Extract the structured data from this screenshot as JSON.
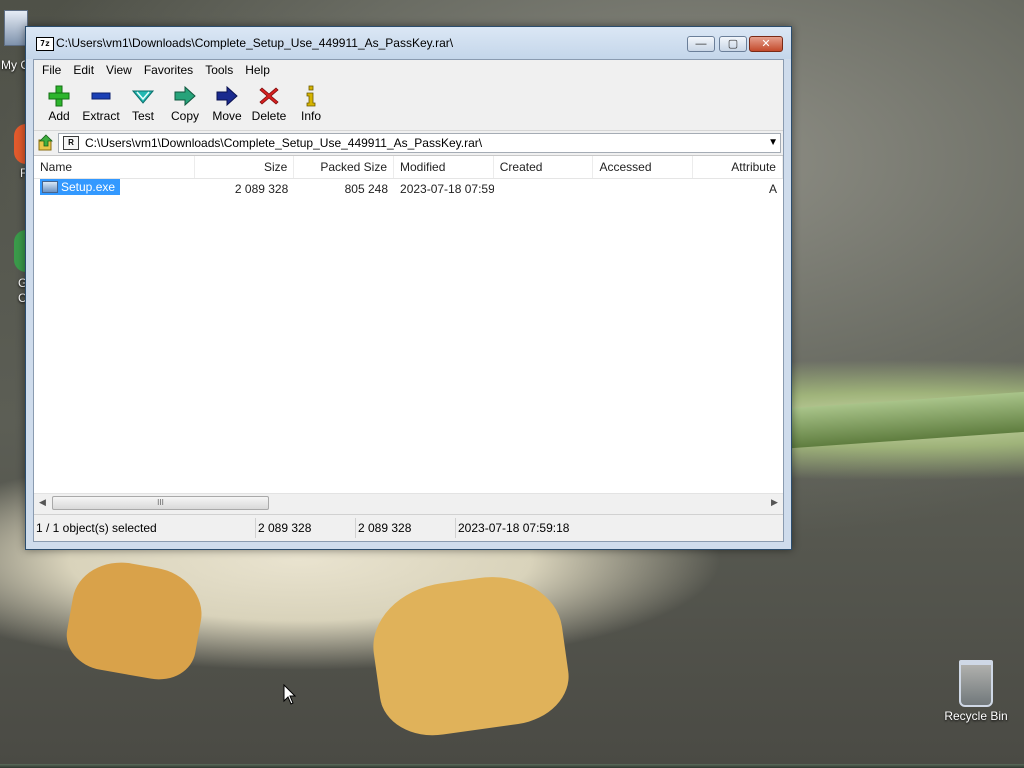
{
  "window": {
    "title": "C:\\Users\\vm1\\Downloads\\Complete_Setup_Use_449911_As_PassKey.rar\\",
    "app_icon_text": "7z",
    "buttons": {
      "minimize": "—",
      "maximize": "▢",
      "close": "✕"
    }
  },
  "menu": [
    "File",
    "Edit",
    "View",
    "Favorites",
    "Tools",
    "Help"
  ],
  "toolbar": [
    {
      "label": "Add",
      "icon": "plus-icon",
      "color": "#2db52d"
    },
    {
      "label": "Extract",
      "icon": "minus-icon",
      "color": "#1a3fb5"
    },
    {
      "label": "Test",
      "icon": "checkmark-icon",
      "color": "#21b9b3"
    },
    {
      "label": "Copy",
      "icon": "copy-arrow-icon",
      "color": "#27a37a"
    },
    {
      "label": "Move",
      "icon": "move-arrow-icon",
      "color": "#1a2a8f"
    },
    {
      "label": "Delete",
      "icon": "delete-x-icon",
      "color": "#d62020"
    },
    {
      "label": "Info",
      "icon": "info-icon",
      "color": "#d6b400"
    }
  ],
  "address": {
    "path": "C:\\Users\\vm1\\Downloads\\Complete_Setup_Use_449911_As_PassKey.rar\\",
    "icon_text": "R"
  },
  "columns": [
    "Name",
    "Size",
    "Packed Size",
    "Modified",
    "Created",
    "Accessed",
    "Attribute"
  ],
  "files": [
    {
      "name": "Setup.exe",
      "size": "2 089 328",
      "packed": "805 248",
      "modified": "2023-07-18 07:59",
      "created": "",
      "accessed": "",
      "attributes": "A",
      "selected": true
    }
  ],
  "status": {
    "selection": "1 / 1 object(s) selected",
    "size": "2 089 328",
    "packed": "2 089 328",
    "modified": "2023-07-18 07:59:18"
  },
  "scrollbar": {
    "thumb_grip": "III"
  },
  "desktop": {
    "recycle_bin": "Recycle Bin",
    "partial_labels": [
      "My C",
      "F",
      "G",
      "C"
    ]
  },
  "colors": {
    "selection": "#3399ff",
    "window_frame": "#cfdcec"
  }
}
